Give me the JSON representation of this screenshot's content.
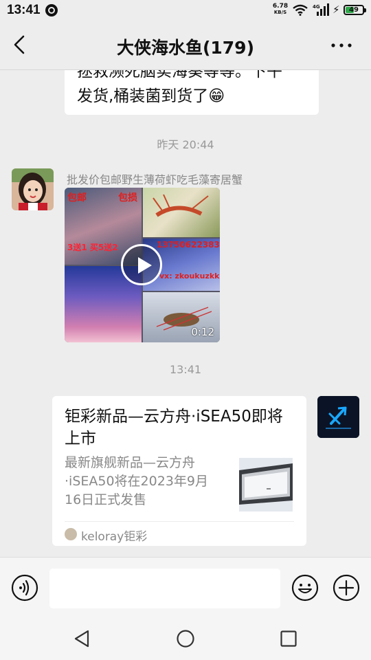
{
  "status_bar": {
    "time": "13:41",
    "net_speed_value": "6.78",
    "net_speed_unit": "KB/S",
    "signal_label": "4G",
    "battery_level": "49"
  },
  "header": {
    "title": "大侠海水鱼(179)"
  },
  "messages": {
    "partial_text_line1": "拯救濒死脑实海葵等等。下午",
    "partial_text_line2": "发货,桶装菌到货了😁",
    "time_divider_1": "昨天 20:44",
    "video": {
      "sender": "批发价包邮野生薄荷虾吃毛藻寄居蟹",
      "overlay_1": "包邮",
      "overlay_2": "包损",
      "overlay_3": "3送1 买5送2",
      "overlay_4": "13750622383",
      "overlay_5": "vx: zkoukuzkk",
      "duration": "0:12"
    },
    "time_divider_2": "13:41",
    "link_card": {
      "title": "钜彩新品—云方舟·iSEA50即将上市",
      "description": "最新旗舰新品—云方舟·iSEA50将在2023年9月16日正式发售",
      "source": "keloray钜彩"
    }
  },
  "input_bar": {
    "placeholder": ""
  },
  "colors": {
    "background": "#ededed",
    "bubble": "#ffffff",
    "battery": "#2ea84a",
    "muted_text": "#888888"
  },
  "icons": [
    "back-icon",
    "more-icon",
    "voice-icon",
    "emoji-icon",
    "plus-icon",
    "play-icon",
    "nav-back-icon",
    "nav-home-icon",
    "nav-recents-icon"
  ]
}
